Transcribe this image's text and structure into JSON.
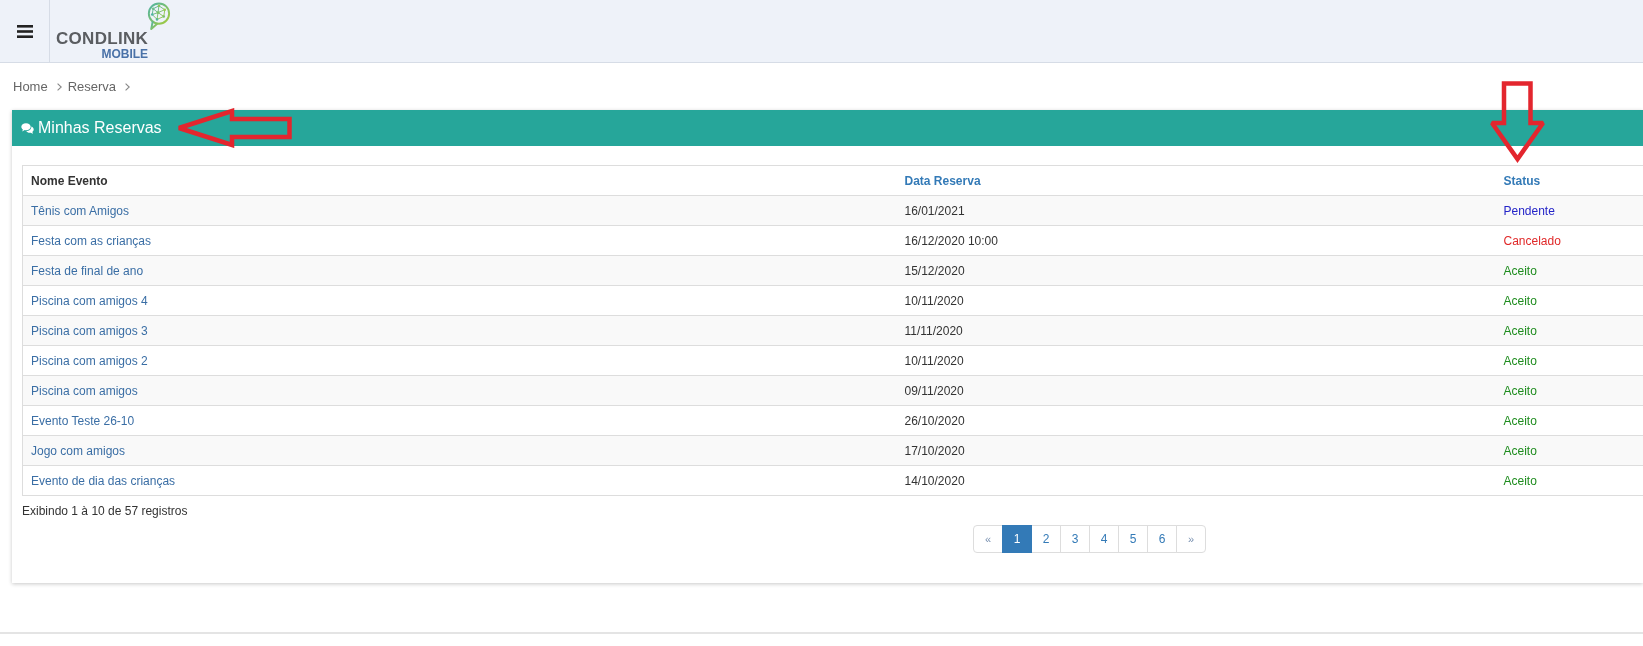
{
  "header": {
    "logo": {
      "name": "CONDLINK",
      "tagline": "MOBILE"
    }
  },
  "breadcrumb": [
    {
      "label": "Home"
    },
    {
      "label": "Reserva"
    }
  ],
  "panel": {
    "title": "Minhas Reservas",
    "annotation_arrow": true
  },
  "table": {
    "columns": [
      {
        "label": "Nome Evento",
        "link": false
      },
      {
        "label": "Data Reserva",
        "link": true
      },
      {
        "label": "Status",
        "link": true,
        "annotation_arrow": true
      }
    ],
    "rows": [
      {
        "name": "Tênis com Amigos",
        "date": "16/01/2021",
        "status": "Pendente",
        "color": "#2424c8"
      },
      {
        "name": "Festa com as crianças",
        "date": "16/12/2020 10:00",
        "status": "Cancelado",
        "color": "#e02828"
      },
      {
        "name": "Festa de final de ano",
        "date": "15/12/2020",
        "status": "Aceito",
        "color": "#1e8c1e"
      },
      {
        "name": "Piscina com amigos 4",
        "date": "10/11/2020",
        "status": "Aceito",
        "color": "#1e8c1e"
      },
      {
        "name": "Piscina com amigos 3",
        "date": "11/11/2020",
        "status": "Aceito",
        "color": "#1e8c1e"
      },
      {
        "name": "Piscina com amigos 2",
        "date": "10/11/2020",
        "status": "Aceito",
        "color": "#1e8c1e"
      },
      {
        "name": "Piscina com amigos",
        "date": "09/11/2020",
        "status": "Aceito",
        "color": "#1e8c1e"
      },
      {
        "name": "Evento Teste 26-10",
        "date": "26/10/2020",
        "status": "Aceito",
        "color": "#1e8c1e"
      },
      {
        "name": "Jogo com amigos",
        "date": "17/10/2020",
        "status": "Aceito",
        "color": "#1e8c1e"
      },
      {
        "name": "Evento de dia das crianças",
        "date": "14/10/2020",
        "status": "Aceito",
        "color": "#1e8c1e"
      }
    ]
  },
  "summary": "Exibindo 1 à 10 de 57 registros",
  "pagination": [
    {
      "kind": "prev",
      "label": "«",
      "selected": false
    },
    {
      "kind": "page",
      "label": "1",
      "selected": true
    },
    {
      "kind": "page",
      "label": "2",
      "selected": false
    },
    {
      "kind": "page",
      "label": "3",
      "selected": false
    },
    {
      "kind": "page",
      "label": "4",
      "selected": false
    },
    {
      "kind": "page",
      "label": "5",
      "selected": false
    },
    {
      "kind": "page",
      "label": "6",
      "selected": false
    },
    {
      "kind": "next",
      "label": "»",
      "selected": false
    }
  ]
}
